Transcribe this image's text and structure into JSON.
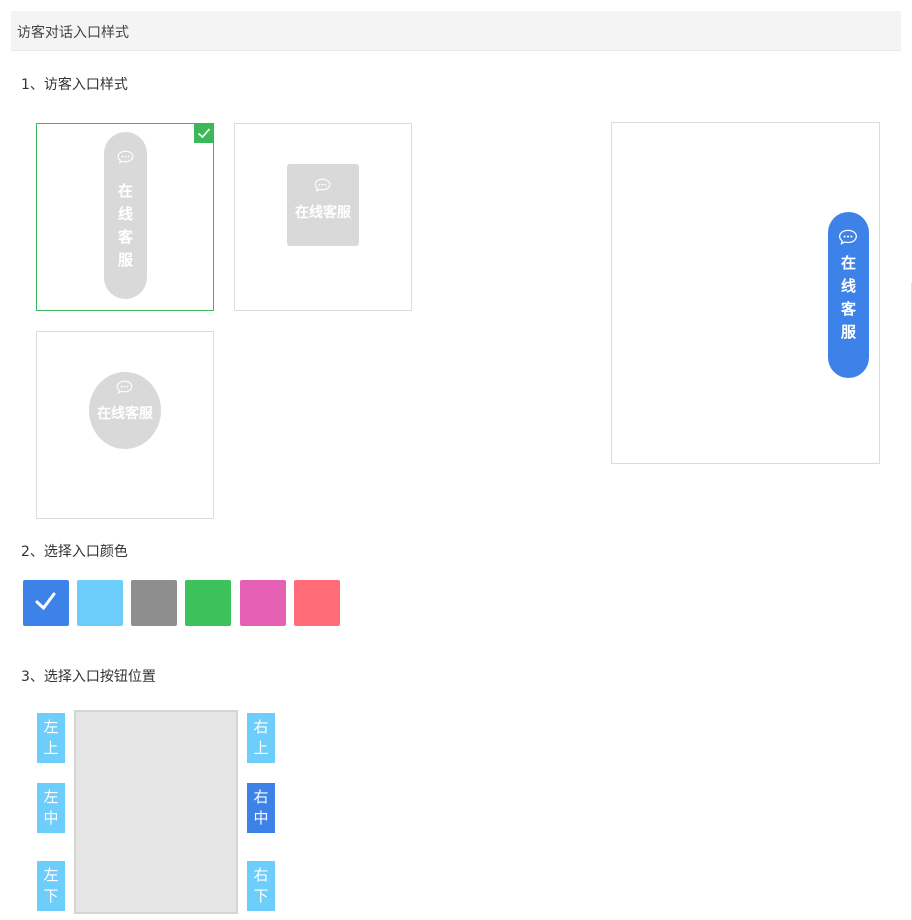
{
  "header": {
    "title": "访客对话入口样式"
  },
  "sections": {
    "style": "1、访客入口样式",
    "color": "2、选择入口颜色",
    "position": "3、选择入口按钮位置"
  },
  "style_options": [
    {
      "name": "vertical-pill",
      "chars": [
        "在",
        "线",
        "客",
        "服"
      ],
      "selected": true
    },
    {
      "name": "square",
      "label": "在线客服",
      "selected": false
    },
    {
      "name": "circle",
      "label": "在线客服",
      "selected": false
    }
  ],
  "preview": {
    "chars": [
      "在",
      "线",
      "客",
      "服"
    ],
    "color": "#3d82e8"
  },
  "colors": [
    {
      "hex": "#3d82e8",
      "selected": true
    },
    {
      "hex": "#6dcdfb",
      "selected": false
    },
    {
      "hex": "#8e8e8e",
      "selected": false
    },
    {
      "hex": "#3bc25a",
      "selected": false
    },
    {
      "hex": "#e661b4",
      "selected": false
    },
    {
      "hex": "#ff6b76",
      "selected": false
    }
  ],
  "positions": {
    "top_left": [
      "左",
      "上"
    ],
    "middle_left": [
      "左",
      "中"
    ],
    "bottom_left": [
      "左",
      "下"
    ],
    "top_right": [
      "右",
      "上"
    ],
    "middle_right": [
      "右",
      "中"
    ],
    "bottom_right": [
      "右",
      "下"
    ],
    "selected": "middle_right"
  },
  "ui_colors": {
    "accent": "#3d82e8",
    "pos_normal": "#6dcdfb",
    "check": "#3bb95a",
    "inactive": "#d9d9d9"
  },
  "icons": {
    "chat": "chat-bubble-icon",
    "check": "checkmark-icon"
  }
}
